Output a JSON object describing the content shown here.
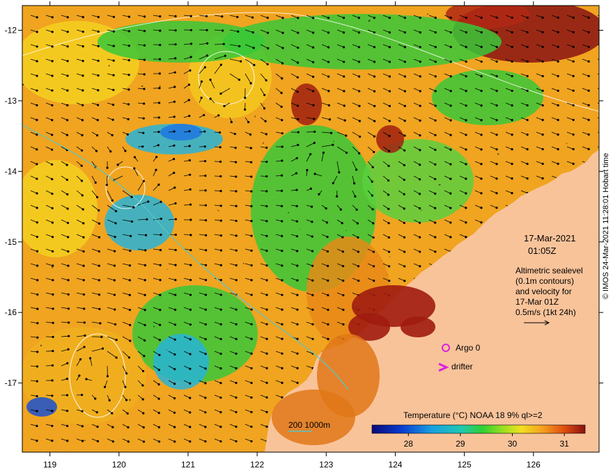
{
  "map": {
    "lon_ticks": [
      "119",
      "120",
      "121",
      "122",
      "123",
      "124",
      "125",
      "126"
    ],
    "lat_ticks": [
      "-12",
      "-13",
      "-14",
      "-15",
      "-16",
      "-17"
    ],
    "lon_range": [
      118.6,
      126.95
    ],
    "lat_range": [
      -17.98,
      -11.65
    ]
  },
  "header": {
    "date": "17-Mar-2021",
    "time": "01:05Z"
  },
  "info": {
    "line1": "Altimetric sealevel",
    "line2": "(0.1m contours)",
    "line3": "and velocity for",
    "line4": "17-Mar 01Z",
    "scale_label": "0.5m/s (1kt 24h)"
  },
  "legend": {
    "argo_label": "Argo 0",
    "drifter_label": "drifter",
    "depth_label": "200  1000m",
    "colorbar_title": "Temperature (°C) NOAA 18 9% ql>=2",
    "colorbar_ticks": [
      "28",
      "29",
      "30",
      "31"
    ],
    "colorbar_range": [
      27.3,
      31.4
    ]
  },
  "credit": "© IMOS 24-Mar-2021 11:28:01 Hobart time",
  "colors": {
    "land": "#f9c39a",
    "argo": "#dd22dd",
    "drifter": "#dd22dd",
    "sealevel_contour": "#ffffff",
    "depth_200": "#55c8c8"
  }
}
